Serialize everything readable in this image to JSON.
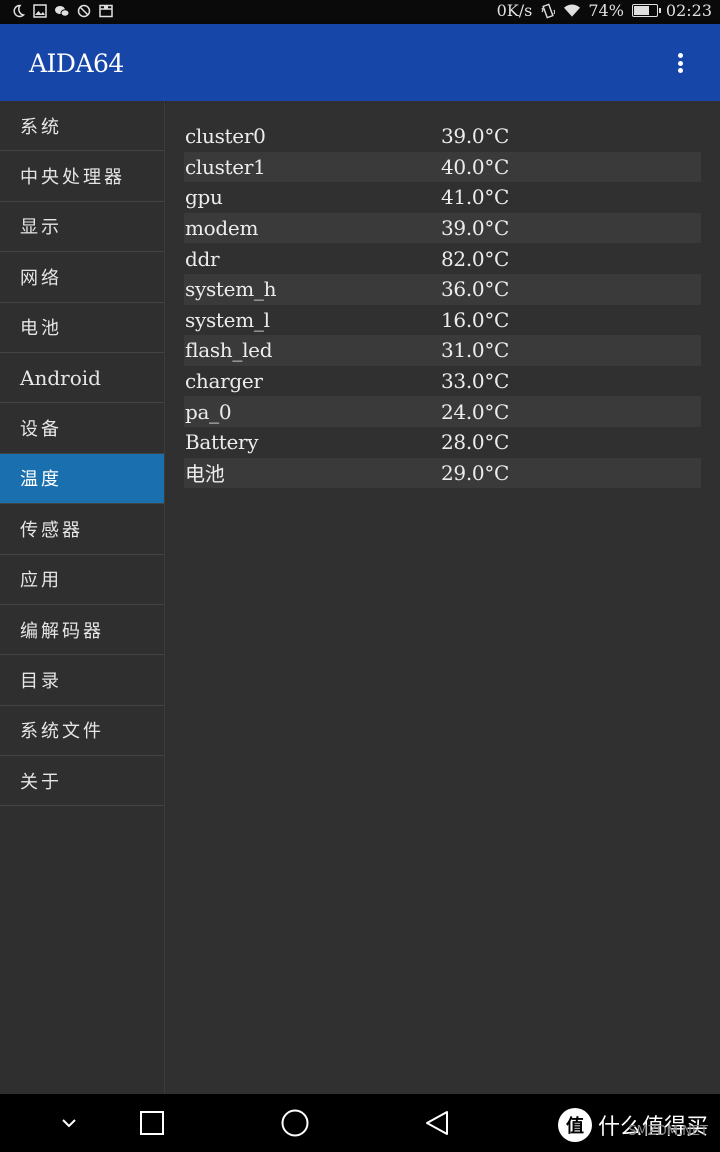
{
  "status_bar": {
    "left_icons": [
      "moon-icon",
      "image-icon",
      "wechat-icon",
      "no-disturb-icon",
      "mail-icon"
    ],
    "net_speed": "0K/s",
    "vibrate_icon": "vibrate-icon",
    "wifi_icon": "wifi-icon",
    "battery_percent": "74%",
    "battery_level": 0.74,
    "time": "02:23"
  },
  "app_bar": {
    "title": "AIDA64",
    "menu_icon": "overflow-menu-icon",
    "color": "#1546a8"
  },
  "sidebar": {
    "active_color": "#1a6fae",
    "items": [
      {
        "label": "系统"
      },
      {
        "label": "中央处理器"
      },
      {
        "label": "显示"
      },
      {
        "label": "网络"
      },
      {
        "label": "电池"
      },
      {
        "label": "Android"
      },
      {
        "label": "设备"
      },
      {
        "label": "温度",
        "active": true
      },
      {
        "label": "传感器"
      },
      {
        "label": "应用"
      },
      {
        "label": "编解码器"
      },
      {
        "label": "目录"
      },
      {
        "label": "系统文件"
      },
      {
        "label": "关于"
      }
    ]
  },
  "temperatures": [
    {
      "name": "cluster0",
      "value": "39.0°C"
    },
    {
      "name": "cluster1",
      "value": "40.0°C"
    },
    {
      "name": "gpu",
      "value": "41.0°C"
    },
    {
      "name": "modem",
      "value": "39.0°C"
    },
    {
      "name": "ddr",
      "value": "82.0°C"
    },
    {
      "name": "system_h",
      "value": "36.0°C"
    },
    {
      "name": "system_l",
      "value": "16.0°C"
    },
    {
      "name": "flash_led",
      "value": "31.0°C"
    },
    {
      "name": "charger",
      "value": "33.0°C"
    },
    {
      "name": "pa_0",
      "value": "24.0°C"
    },
    {
      "name": "Battery",
      "value": "28.0°C"
    },
    {
      "name": "电池",
      "value": "29.0°C"
    }
  ],
  "nav_bar": {
    "buttons": [
      "chevron-down-icon",
      "recents-icon",
      "home-icon",
      "back-icon"
    ]
  },
  "watermark": {
    "badge": "值",
    "text": "什么值得买",
    "sub": "SMZDM.NET"
  }
}
